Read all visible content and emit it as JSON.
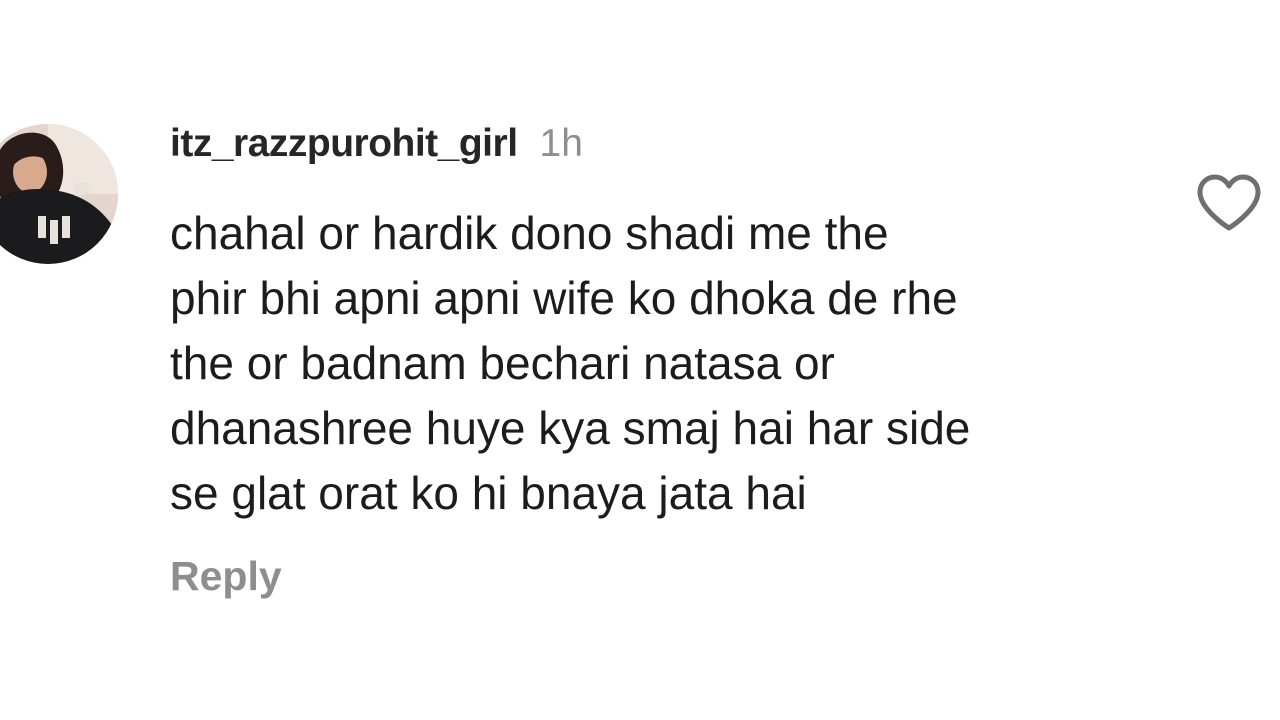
{
  "comment": {
    "username": "itz_razzpurohit_girl",
    "timestamp": "1h",
    "text": "chahal or hardik dono shadi me the\nphir bhi apni apni wife ko dhoka de rhe\nthe or badnam bechari natasa or\ndhanashree huye kya smaj hai har side\nse glat orat ko hi bnaya jata hai",
    "reply_label": "Reply",
    "like_icon": "heart-outline-icon",
    "avatar_icon": "profile-photo"
  }
}
